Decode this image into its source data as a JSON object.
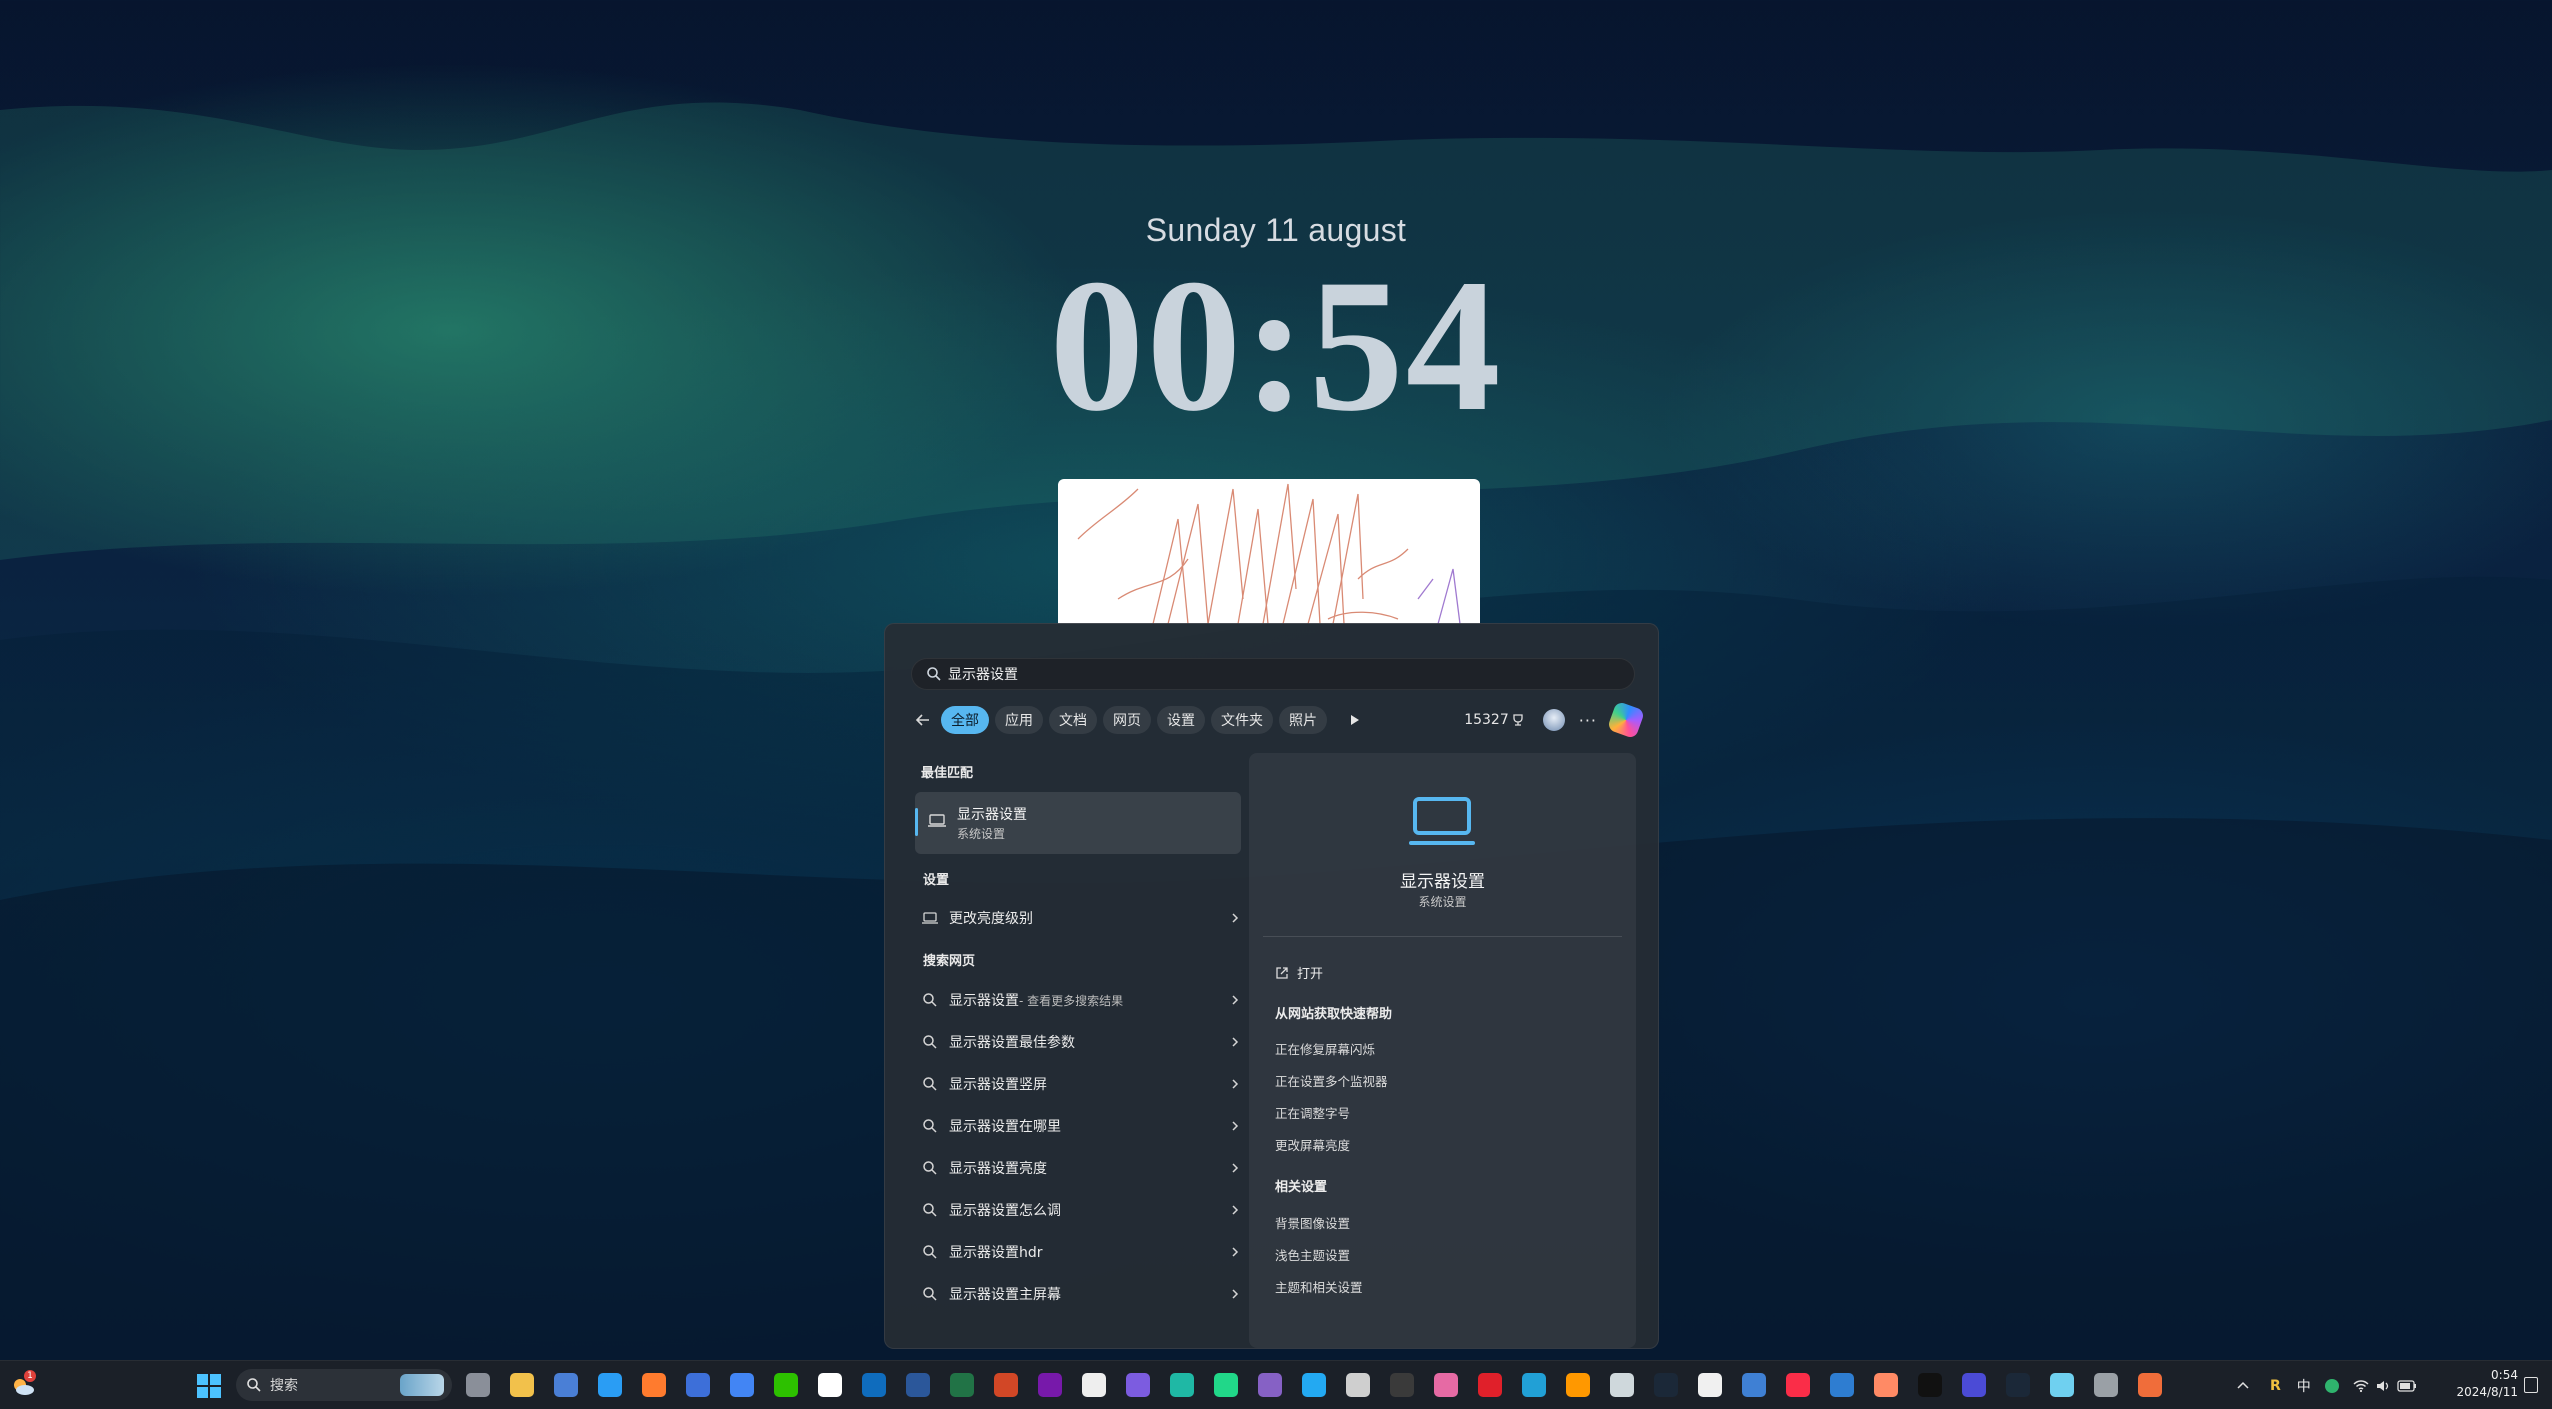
{
  "lock_screen": {
    "date": "Sunday 11 august",
    "time": "00:54"
  },
  "search_panel": {
    "query": "显示器设置",
    "filters": [
      "全部",
      "应用",
      "文档",
      "网页",
      "设置",
      "文件夹",
      "照片"
    ],
    "active_filter": "全部",
    "reward_points": "15327",
    "more_label": "···",
    "best_match": {
      "section_title": "最佳匹配",
      "title": "显示器设置",
      "subtitle": "系统设置"
    },
    "settings": {
      "section_title": "设置",
      "items": [
        "更改亮度级别"
      ]
    },
    "web": {
      "section_title": "搜索网页",
      "first_item_main": "显示器设置",
      "first_item_sub": " - 查看更多搜索结果",
      "items": [
        "显示器设置最佳参数",
        "显示器设置竖屏",
        "显示器设置在哪里",
        "显示器设置亮度",
        "显示器设置怎么调",
        "显示器设置hdr",
        "显示器设置主屏幕"
      ]
    },
    "preview": {
      "title": "显示器设置",
      "subtitle": "系统设置",
      "open_label": "打开",
      "help_title": "从网站获取快速帮助",
      "help_links": [
        "正在修复屏幕闪烁",
        "正在设置多个监视器",
        "正在调整字号",
        "更改屏幕亮度"
      ],
      "related_title": "相关设置",
      "related_links": [
        "背景图像设置",
        "浅色主题设置",
        "主题和相关设置"
      ]
    }
  },
  "taskbar": {
    "search_placeholder": "搜索",
    "widgets_badge": "1",
    "tray_ime_r": "R",
    "tray_ime_lang": "中",
    "clock_time": "0:54",
    "clock_date": "2024/8/11",
    "apps": [
      "task-view-icon",
      "file-explorer-icon",
      "microsoft-store-icon",
      "edge-icon",
      "firefox-icon",
      "app-star-icon",
      "chrome-icon",
      "wechat-icon",
      "qq-icon",
      "outlook-icon",
      "word-icon",
      "excel-icon",
      "powerpoint-icon",
      "onenote-icon",
      "typora-icon",
      "obsidian-icon",
      "typst-icon",
      "pycharm-icon",
      "visual-studio-icon",
      "vscode-icon",
      "app-gear-icon",
      "terminal-icon",
      "app-pink-icon",
      "netease-music-icon",
      "vim-icon",
      "sublime-icon",
      "app-tools-icon",
      "steam-icon",
      "github-icon",
      "app-calendar-icon",
      "apple-music-icon",
      "app-blue-icon",
      "app-colorful-icon",
      "capcut-icon",
      "app-circle-icon",
      "steam2-icon",
      "app-triangle-icon",
      "settings-icon",
      "app-photo-icon"
    ]
  },
  "colors": {
    "accent": "#57b7f0",
    "panel_bg": "#262c34",
    "taskbar_bg": "#1c2028"
  }
}
